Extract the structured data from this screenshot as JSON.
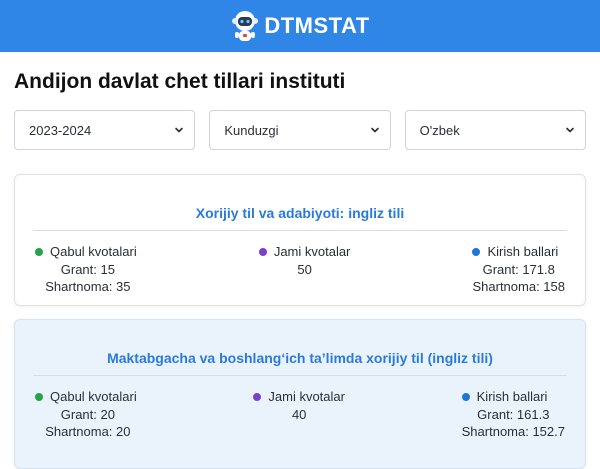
{
  "header": {
    "brand": "DTMSTAT",
    "brand_color": "#2f86e6"
  },
  "page": {
    "title": "Andijon davlat chet tillari instituti"
  },
  "filters": [
    {
      "value": "2023-2024"
    },
    {
      "value": "Kunduzgi"
    },
    {
      "value": "O'zbek"
    }
  ],
  "colors": {
    "quota": "#22a447",
    "total": "#7b3fd0",
    "score": "#1e77d8",
    "title": "#2a7bd8"
  },
  "cards": [
    {
      "title": "Xorijiy til va adabiyoti: ingliz tili",
      "quota_label": "Qabul kvotalari",
      "quota_grant": "Grant: 15",
      "quota_contract": "Shartnoma: 35",
      "total_label": "Jami kvotalar",
      "total_value": "50",
      "score_label": "Kirish ballari",
      "score_grant": "Grant: 171.8",
      "score_contract": "Shartnoma: 158"
    },
    {
      "title": "Maktabgacha va boshlang‘ich ta’limda xorijiy til (ingliz tili)",
      "quota_label": "Qabul kvotalari",
      "quota_grant": "Grant: 20",
      "quota_contract": "Shartnoma: 20",
      "total_label": "Jami kvotalar",
      "total_value": "40",
      "score_label": "Kirish ballari",
      "score_grant": "Grant: 161.3",
      "score_contract": "Shartnoma: 152.7"
    }
  ]
}
